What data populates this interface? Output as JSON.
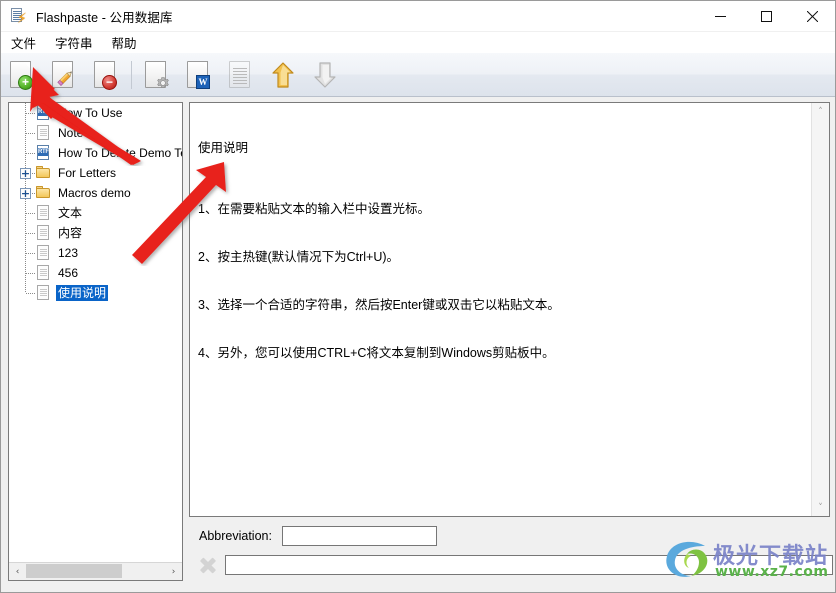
{
  "window": {
    "title": "Flashpaste - 公用数据库",
    "icon": "document-lightning-icon",
    "minimize_label": "–",
    "maximize_label": "□",
    "close_label": "✕"
  },
  "menu": {
    "items": [
      {
        "label": "文件"
      },
      {
        "label": "字符串"
      },
      {
        "label": "帮助"
      }
    ]
  },
  "toolbar": {
    "buttons": [
      {
        "name": "new-entry-button",
        "icon": "new-document-icon",
        "enabled": true,
        "tip": "新建"
      },
      {
        "name": "edit-entry-button",
        "icon": "edit-pencil-icon",
        "enabled": true,
        "tip": "编辑"
      },
      {
        "name": "delete-entry-button",
        "icon": "delete-document-icon",
        "enabled": true,
        "tip": "删除"
      },
      {
        "name": "settings-button",
        "icon": "gear-document-icon",
        "enabled": true,
        "tip": "设置"
      },
      {
        "name": "word-export-button",
        "icon": "word-document-icon",
        "enabled": true,
        "tip": "导出 Word"
      },
      {
        "name": "text-view-button",
        "icon": "text-document-icon",
        "enabled": false,
        "tip": "文本"
      },
      {
        "name": "move-up-button",
        "icon": "arrow-up-icon",
        "enabled": true,
        "tip": "上移"
      },
      {
        "name": "move-down-button",
        "icon": "arrow-down-icon",
        "enabled": false,
        "tip": "下移"
      }
    ]
  },
  "tree": {
    "items": [
      {
        "label": "How To Use",
        "icon": "rtf-file-icon",
        "expander": "",
        "indent": 0,
        "selected": false,
        "last": false
      },
      {
        "label": "Note",
        "icon": "text-file-icon",
        "expander": "",
        "indent": 0,
        "selected": false,
        "last": false
      },
      {
        "label": "How To Delete Demo Text",
        "icon": "rtf-file-icon",
        "expander": "",
        "indent": 0,
        "selected": false,
        "last": false
      },
      {
        "label": "For Letters",
        "icon": "folder-icon",
        "expander": "+",
        "indent": 0,
        "selected": false,
        "last": false
      },
      {
        "label": "Macros demo",
        "icon": "folder-icon",
        "expander": "+",
        "indent": 0,
        "selected": false,
        "last": false
      },
      {
        "label": "文本",
        "icon": "text-file-icon",
        "expander": "",
        "indent": 0,
        "selected": false,
        "last": false
      },
      {
        "label": "内容",
        "icon": "text-file-icon",
        "expander": "",
        "indent": 0,
        "selected": false,
        "last": false
      },
      {
        "label": "123",
        "icon": "text-file-icon",
        "expander": "",
        "indent": 0,
        "selected": false,
        "last": false
      },
      {
        "label": "456",
        "icon": "text-file-icon",
        "expander": "",
        "indent": 0,
        "selected": false,
        "last": false
      },
      {
        "label": "使用说明",
        "icon": "text-file-icon",
        "expander": "",
        "indent": 0,
        "selected": true,
        "last": true
      }
    ],
    "hscroll": {
      "left_arrow": "‹",
      "right_arrow": "›",
      "thumb_position": 0
    }
  },
  "content": {
    "title": "使用说明",
    "lines": [
      "1、在需要粘贴文本的输入栏中设置光标。",
      "2、按主热键(默认情况下为Ctrl+U)。",
      "3、选择一个合适的字符串，然后按Enter键或双击它以粘贴文本。",
      "4、另外，您可以使用CTRL+C将文本复制到Windows剪贴板中。"
    ],
    "vscroll": {
      "up_arrow": "˄",
      "down_arrow": "˅"
    }
  },
  "form": {
    "abbreviation_label": "Abbreviation:",
    "abbreviation_value": "",
    "abbreviation_placeholder": "",
    "search_value": "",
    "search_placeholder": "",
    "clear_icon": "clear-x-icon"
  },
  "watermark": {
    "text": "极光下载站",
    "url": "www.xz7.com",
    "logo": "jiguang-swirl-logo"
  },
  "colors": {
    "selection_blue": "#0a64c8",
    "toolbar_gradient_top": "#f6f8fb",
    "toolbar_gradient_bottom": "#dde3ec",
    "annotation_red": "#e8201a",
    "watermark_purple": "#7a83c8",
    "watermark_green": "#5ab24a"
  },
  "annotations": [
    {
      "name": "arrow-to-new-button",
      "points_to": "new-entry-button"
    },
    {
      "name": "arrow-to-content-pane",
      "points_to": "content-pane"
    }
  ]
}
